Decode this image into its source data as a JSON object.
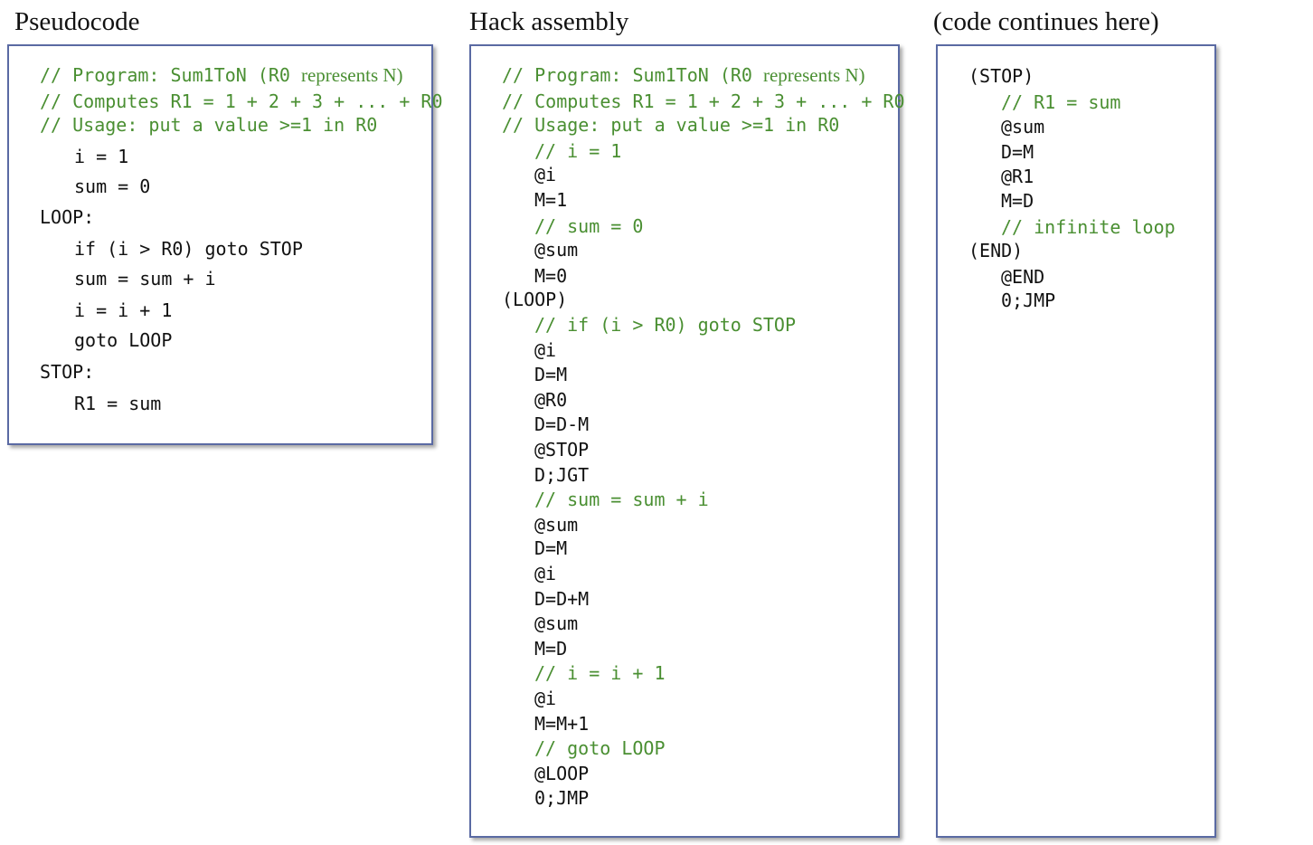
{
  "headings": {
    "pseudocode": "Pseudocode",
    "hack": "Hack assembly",
    "continues": "(code continues here)"
  },
  "pseudocode": {
    "comment1_a": "// Program: Sum1ToN (R0 ",
    "comment1_b": "represents N)",
    "comment2": "// Computes R1 = 1 + 2 + 3 + ... + R0",
    "comment3": "// Usage: put a value >=1 in R0",
    "lines": [
      "i = 1",
      "sum = 0",
      "LOOP:",
      "if (i > R0) goto STOP",
      "sum = sum + i",
      "i = i + 1",
      "goto LOOP",
      "STOP:",
      "R1 = sum"
    ]
  },
  "hack": {
    "comment1_a": "// Program: Sum1ToN (R0 ",
    "comment1_b": "represents N)",
    "comment2": "// Computes R1 = 1 + 2 + 3 + ... + R0",
    "comment3": "// Usage: put a value >=1 in R0",
    "lines": [
      "// i = 1",
      "@i",
      "M=1",
      "// sum = 0",
      "@sum",
      "M=0",
      "(LOOP)",
      "// if (i > R0) goto STOP",
      "@i",
      "D=M",
      "@R0",
      "D=D-M",
      "@STOP",
      "D;JGT",
      "// sum = sum + i",
      "@sum",
      "D=M",
      "@i",
      "D=D+M",
      "@sum",
      "M=D",
      "// i = i + 1",
      "@i",
      "M=M+1",
      "// goto LOOP",
      "@LOOP",
      "0;JMP"
    ]
  },
  "continued": {
    "lines": [
      "(STOP)",
      "// R1 = sum",
      "@sum",
      "D=M",
      "@R1",
      "M=D",
      "// infinite loop",
      "(END)",
      "@END",
      "0;JMP"
    ]
  }
}
